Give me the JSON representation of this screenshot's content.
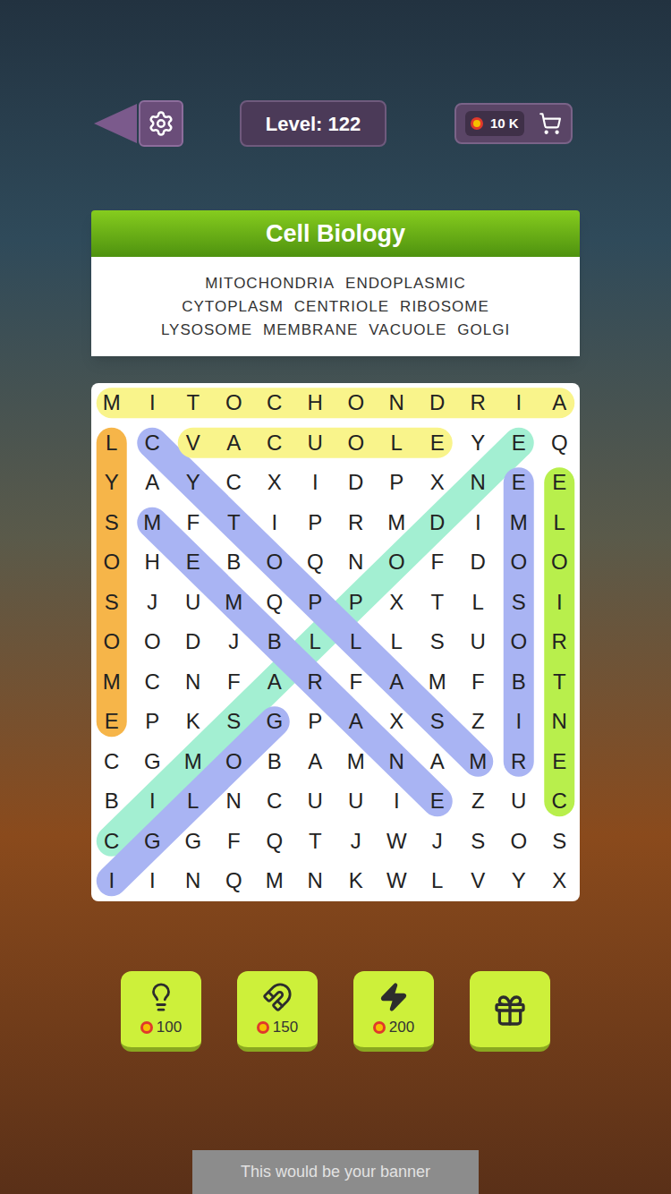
{
  "top_bar": {
    "level": "Level: 122",
    "coins": "10 K"
  },
  "category": {
    "title": "Cell Biology",
    "words": [
      "MITOCHONDRIA",
      "ENDOPLASMIC",
      "CYTOPLASM",
      "CENTRIOLE",
      "RIBOSOME",
      "LYSOSOME",
      "MEMBRANE",
      "VACUOLE",
      "GOLGI"
    ]
  },
  "grid": {
    "rows": [
      "MITOCHONDRIA",
      "LCVACUOLEYEQ",
      "YAYCXIDPXNEE",
      "SMFTIPRMDIML",
      "OHEBOQNOFDOO",
      "SJUMQPPXTLSI",
      "OODJBLLLSUOR",
      "MCNFARFAMFBT",
      "EPKSGPAXSZIN",
      "CGMOBAMNAMRE",
      "BILNCUUIEZUC",
      "CGGFQTJWJSOS",
      "IINQMNKWLVYX"
    ],
    "found": [
      {
        "word": "ENDOPLASMIC",
        "start": [
          1,
          10
        ],
        "end": [
          11,
          0
        ],
        "color": "#a3efd2"
      },
      {
        "word": "CYTOPLASM",
        "start": [
          1,
          1
        ],
        "end": [
          9,
          9
        ],
        "color": "#a9b4f3"
      },
      {
        "word": "MEMBRANE",
        "start": [
          3,
          1
        ],
        "end": [
          10,
          8
        ],
        "color": "#a9b4f3"
      },
      {
        "word": "GOLGI",
        "start": [
          8,
          4
        ],
        "end": [
          12,
          0
        ],
        "color": "#a9b4f3"
      },
      {
        "word": "RIBOSOME",
        "start": [
          9,
          10
        ],
        "end": [
          2,
          10
        ],
        "color": "#a9b4f3"
      },
      {
        "word": "CENTRIOLE",
        "start": [
          10,
          11
        ],
        "end": [
          2,
          11
        ],
        "color": "#b8ef4c"
      },
      {
        "word": "LYSOSOME",
        "start": [
          1,
          0
        ],
        "end": [
          8,
          0
        ],
        "color": "#f6b549"
      },
      {
        "word": "MITOCHONDRIA",
        "start": [
          0,
          0
        ],
        "end": [
          0,
          11
        ],
        "color": "#f9f48b"
      },
      {
        "word": "VACUOLE",
        "start": [
          1,
          2
        ],
        "end": [
          1,
          8
        ],
        "color": "#f9f48b"
      }
    ]
  },
  "powerups": [
    {
      "kind": "hint",
      "price": "100"
    },
    {
      "kind": "magnet",
      "price": "150"
    },
    {
      "kind": "bolt",
      "price": "200"
    },
    {
      "kind": "video"
    }
  ],
  "banner": {
    "text": "This would be your banner"
  }
}
